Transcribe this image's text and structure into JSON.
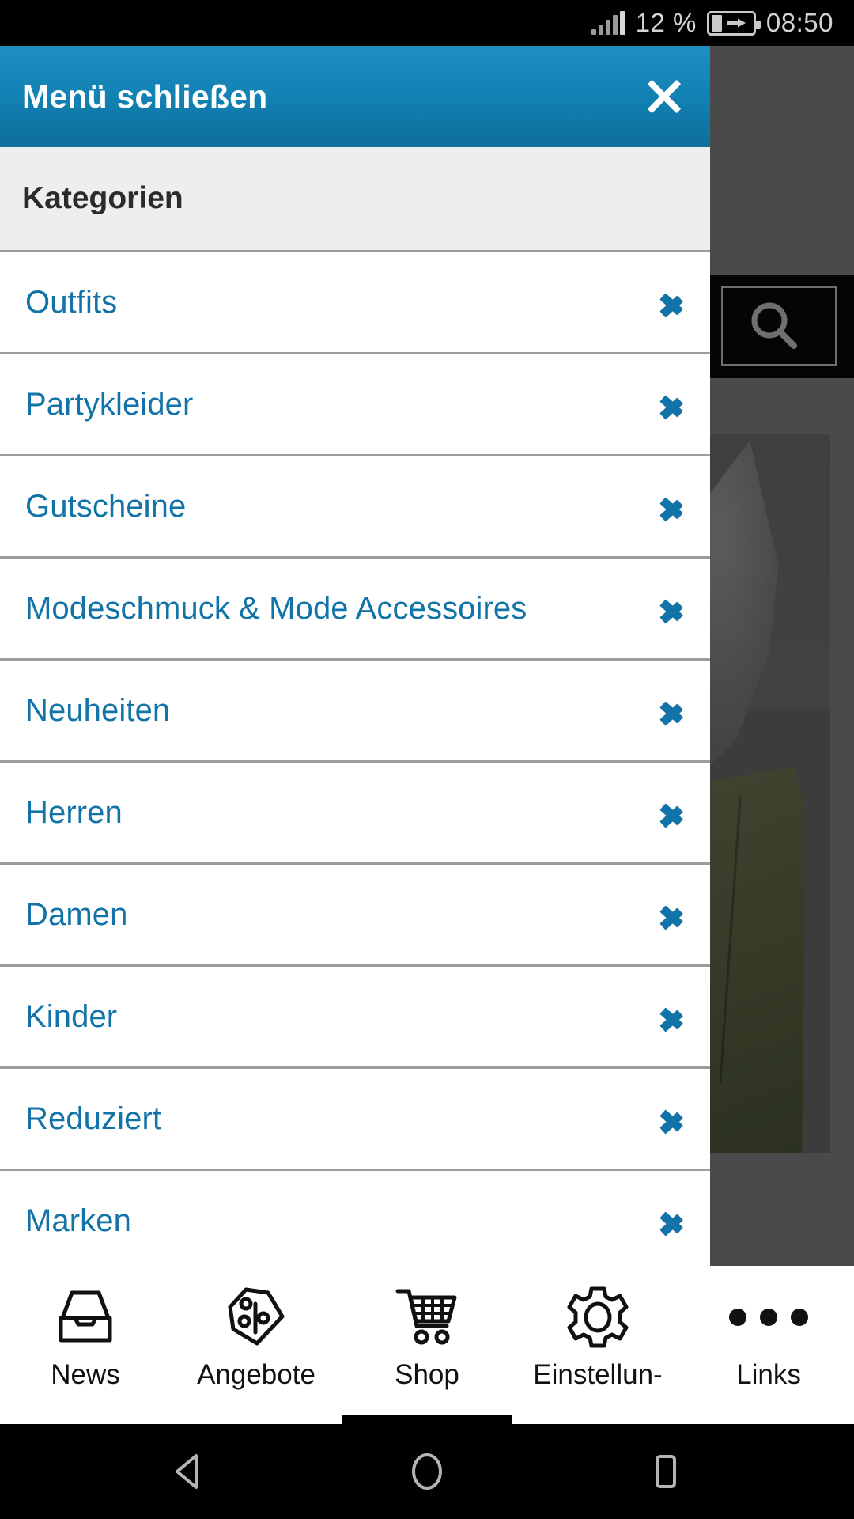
{
  "status_bar": {
    "signal_icon": "signal-bars-icon",
    "battery_percent": "12 %",
    "battery_icon": "battery-charging-icon",
    "clock": "08:50"
  },
  "menu": {
    "header": {
      "title": "Menü schließen",
      "close_icon": "close-icon"
    },
    "section_title": "Kategorien",
    "chevron_icon": "chevron-right-icon",
    "items": [
      {
        "label": "Outfits"
      },
      {
        "label": "Partykleider"
      },
      {
        "label": "Gutscheine"
      },
      {
        "label": "Modeschmuck & Mode Accessoires"
      },
      {
        "label": "Neuheiten"
      },
      {
        "label": "Herren"
      },
      {
        "label": "Damen"
      },
      {
        "label": "Kinder"
      },
      {
        "label": "Reduziert"
      },
      {
        "label": "Marken"
      }
    ]
  },
  "background_page": {
    "search_icon": "search-icon"
  },
  "tab_bar": {
    "tabs": [
      {
        "label": "News",
        "icon": "inbox-tray-icon",
        "active": false
      },
      {
        "label": "Angebote",
        "icon": "price-tag-percent-icon",
        "active": false
      },
      {
        "label": "Shop",
        "icon": "shopping-cart-icon",
        "active": true
      },
      {
        "label": "Einstellun-",
        "icon": "gear-icon",
        "active": false
      },
      {
        "label": "Links",
        "icon": "more-dots-icon",
        "active": false
      }
    ]
  },
  "nav_bar": {
    "back_icon": "back-triangle-icon",
    "home_icon": "home-circle-icon",
    "recents_icon": "recents-square-icon"
  },
  "colors": {
    "header_blue_top": "#1f8fc2",
    "header_blue_bottom": "#0d6f9c",
    "link_blue": "#1273a8",
    "section_grey": "#eeeeee",
    "divider_grey": "#9d9d9d",
    "scrim": "#4a4a4a"
  }
}
